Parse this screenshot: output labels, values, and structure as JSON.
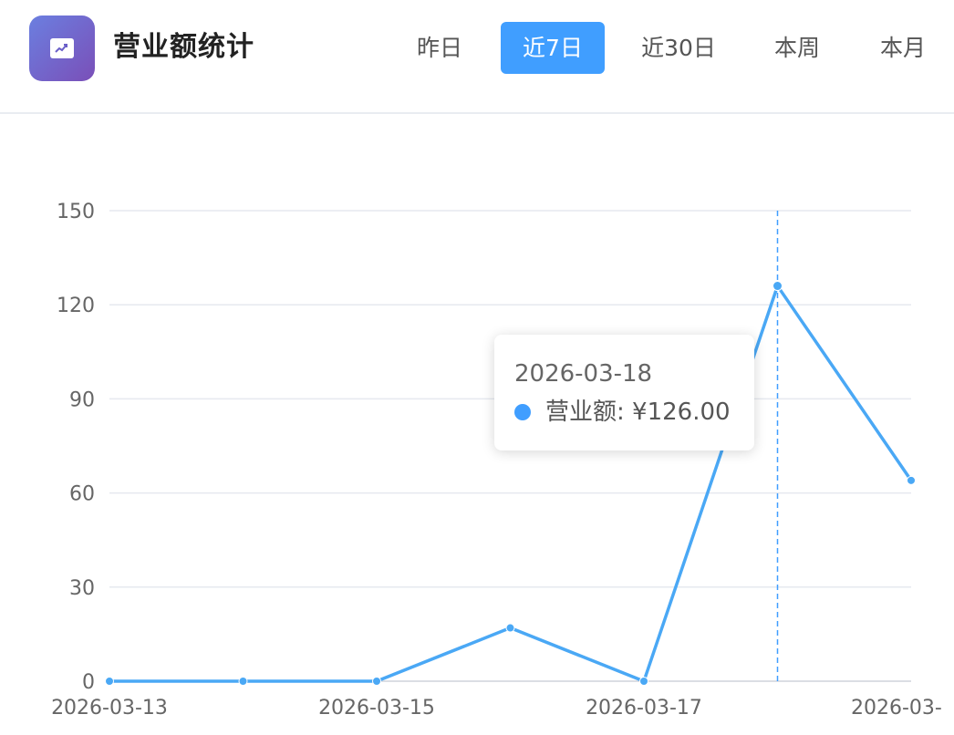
{
  "header": {
    "icon": "trend-chart-icon",
    "title": "营业额统计",
    "tabs": [
      {
        "label": "昨日",
        "active": false
      },
      {
        "label": "近7日",
        "active": true
      },
      {
        "label": "近30日",
        "active": false
      },
      {
        "label": "本周",
        "active": false
      },
      {
        "label": "本月",
        "active": false
      }
    ]
  },
  "colors": {
    "accent": "#409eff",
    "line": "#4aa8f5",
    "grid": "#e6e9ef",
    "axis": "#cfd4dc"
  },
  "tooltip": {
    "date": "2026-03-18",
    "series_name": "营业额",
    "value_text": "¥126.00"
  },
  "chart_data": {
    "type": "line",
    "x": [
      "2026-03-13",
      "2026-03-14",
      "2026-03-15",
      "2026-03-16",
      "2026-03-17",
      "2026-03-18",
      "2026-03-19"
    ],
    "x_tick_labels": [
      "2026-03-13",
      "2026-03-15",
      "2026-03-17",
      "2026-03-"
    ],
    "series": [
      {
        "name": "营业额",
        "values": [
          0,
          0,
          0,
          17,
          0,
          126,
          64
        ]
      }
    ],
    "ylim": [
      0,
      150
    ],
    "y_ticks": [
      0,
      30,
      60,
      90,
      120,
      150
    ],
    "grid": true,
    "highlighted_index": 5,
    "title": "",
    "xlabel": "",
    "ylabel": ""
  }
}
